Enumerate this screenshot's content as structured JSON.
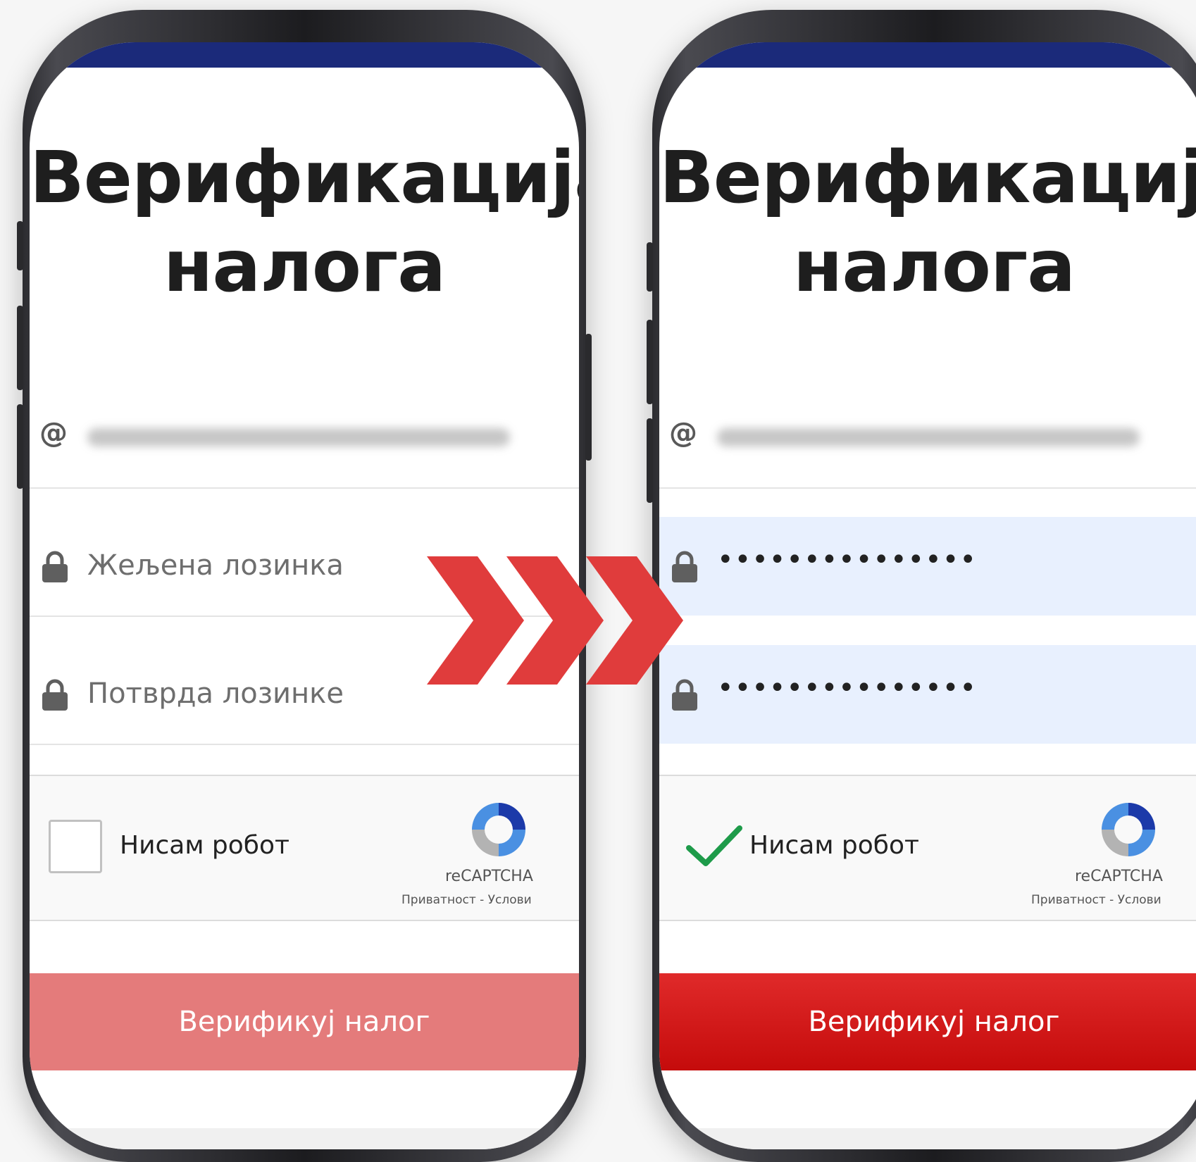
{
  "left_phone": {
    "title_line1": "Верификација",
    "title_line2": "налога",
    "email_symbol": "@",
    "password_placeholder": "Жељена лозинка",
    "confirm_placeholder": "Потврда лозинке",
    "captcha_label": "Нисам робот",
    "captcha_checked": false,
    "recaptcha_brand": "reCAPTCHA",
    "recaptcha_links": "Приватност - Услови",
    "submit_label": "Верификуј налог"
  },
  "right_phone": {
    "title_line1": "Верификација",
    "title_line2": "налога",
    "email_symbol": "@",
    "password_value": "•••••••••••••••",
    "confirm_value": "•••••••••••••••",
    "captcha_label": "Нисам робот",
    "captcha_checked": true,
    "recaptcha_brand": "reCAPTCHA",
    "recaptcha_links": "Приватност - Услови",
    "submit_label": "Верификуј налог"
  },
  "icons": {
    "email": "at-icon",
    "password": "lock-icon",
    "captcha": "recaptcha-logo-icon",
    "transition": "triple-chevron-right-icon"
  },
  "colors": {
    "topbar": "#1b2a7a",
    "submit_disabled": "#e47b7b",
    "submit_enabled": "#cc1111",
    "autofill_bg": "#e8f0fe",
    "chevron": "#e03c3c",
    "checkmark": "#1e9b4a"
  }
}
